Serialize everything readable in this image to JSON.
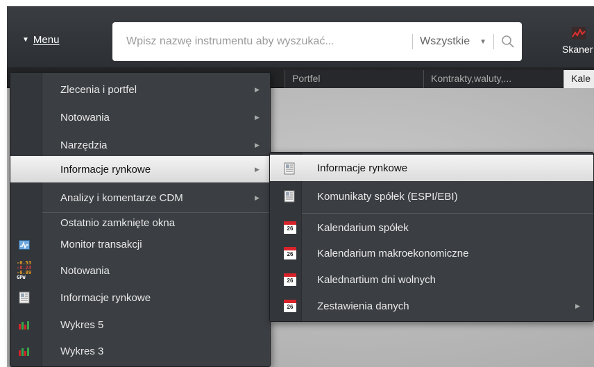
{
  "toolbar": {
    "menu_label": "Menu",
    "search_placeholder": "Wpisz nazwę instrumentu aby wyszukać...",
    "scope_value": "Wszystkie",
    "skaner_label": "Skaner"
  },
  "tabs": [
    {
      "label": "Portfel"
    },
    {
      "label": "Kontrakty,waluty,..."
    },
    {
      "label": "Kale"
    }
  ],
  "menu": {
    "items": [
      {
        "label": "Zlecenia i portfel",
        "has_submenu": true
      },
      {
        "label": "Notowania",
        "has_submenu": true
      },
      {
        "label": "Narzędzia",
        "has_submenu": true
      },
      {
        "label": "Informacje rynkowe",
        "has_submenu": true,
        "highlighted": true
      },
      {
        "label": "Analizy i komentarze CDM",
        "has_submenu": true
      }
    ],
    "recent_header": "Ostatnio zamknięte okna",
    "recent": [
      {
        "label": "Monitor transakcji",
        "icon": "monitor-icon"
      },
      {
        "label": "Notowania",
        "icon": "gpw-quotes-icon"
      },
      {
        "label": "Informacje rynkowe",
        "icon": "document-icon"
      },
      {
        "label": "Wykres 5",
        "icon": "chart-icon"
      },
      {
        "label": "Wykres 3",
        "icon": "chart-icon"
      }
    ]
  },
  "submenu": {
    "items": [
      {
        "label": "Informacje rynkowe",
        "icon": "document-icon",
        "highlighted": true
      },
      {
        "label": "Komunikaty spółek (ESPI/EBI)",
        "icon": "document-icon"
      },
      {
        "label": "Kalendarium spółek",
        "icon": "calendar-icon"
      },
      {
        "label": "Kalendarium makroekonomiczne",
        "icon": "calendar-icon"
      },
      {
        "label": "Kalednartium dni wolnych",
        "icon": "calendar-icon"
      },
      {
        "label": "Zestawienia danych",
        "icon": "calendar-icon",
        "has_submenu": true
      }
    ],
    "calendar_day": "26"
  },
  "icons": {
    "gpw_values": [
      "-0.53",
      "-8.23",
      "-0.09"
    ],
    "gpw_label": "GPW"
  },
  "colors": {
    "toolbar_bg": "#2f3236",
    "menu_bg": "#3b3e42",
    "highlight_bg": "#e8e8e8",
    "calendar_red": "#d8232a",
    "chart_green": "#3aa64a",
    "chart_red": "#d8232a"
  }
}
